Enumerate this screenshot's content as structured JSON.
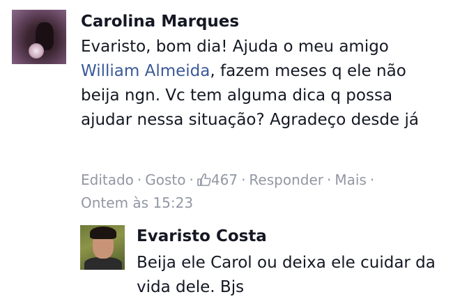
{
  "comment": {
    "author": "Carolina Marques",
    "text_before_mention": "Evaristo, bom dia! Ajuda o meu amigo",
    "mention": "William Almeida",
    "text_after_mention": ", fazem meses q ele não beija ngn. Vc tem alguma dica q possa ajudar nessa situação? Agradeço desde já",
    "edited_label": "Editado",
    "like_label": "Gosto",
    "like_count": "467",
    "reply_label": "Responder",
    "more_label": "Mais",
    "timestamp": "Ontem às 15:23",
    "separator": "·"
  },
  "reply": {
    "author": "Evaristo Costa",
    "text": "Beija ele Carol ou deixa ele cuidar da vida dele. Bjs"
  },
  "colors": {
    "name": "#141823",
    "link": "#3b5998",
    "meta": "#9197a3"
  },
  "icons": {
    "like": "thumbs-up-icon"
  }
}
